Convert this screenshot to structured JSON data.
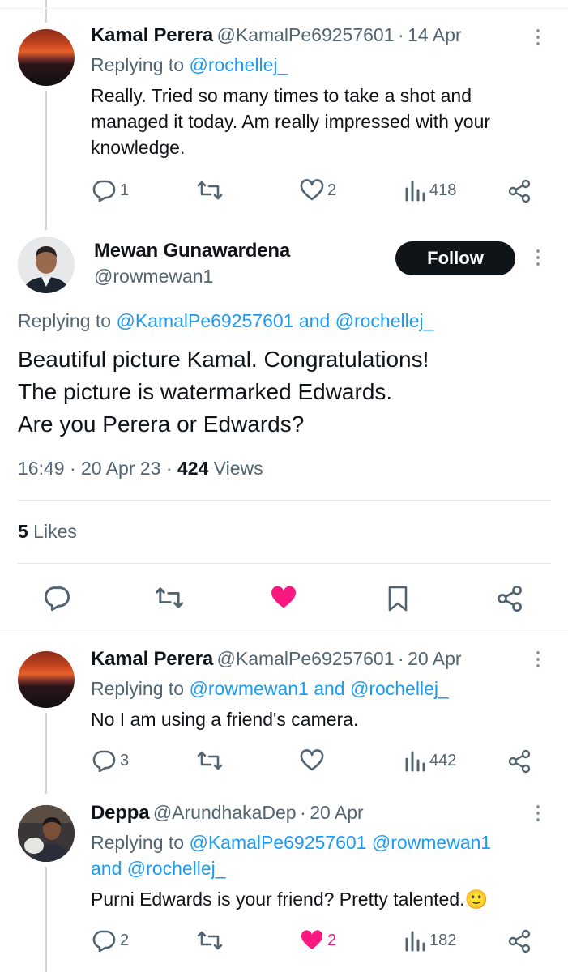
{
  "tweets": [
    {
      "name": "Kamal Perera",
      "handle": "@KamalPe69257601",
      "dot": "·",
      "date": "14 Apr",
      "replying_prefix": "Replying to",
      "replying_to": "@rochellej_",
      "text_lines": [
        "Really. Tried so many times to take a shot and",
        "managed it today. Am really impressed with your",
        "knowledge."
      ],
      "replies": "1",
      "retweets": "",
      "likes": "2",
      "views": "418"
    },
    {
      "name": "Kamal Perera",
      "handle": "@KamalPe69257601",
      "dot": "·",
      "date": "20 Apr",
      "replying_prefix": "Replying to",
      "replying_to": "@rowmewan1 and @rochellej_",
      "text_lines": [
        "No I am using a friend's camera."
      ],
      "replies": "3",
      "likes": "",
      "views": "442"
    },
    {
      "name": "Deppa",
      "handle": "@ArundhakaDep",
      "dot": "·",
      "date": "20 Apr",
      "replying_prefix": "Replying to",
      "replying_line1": "@KamalPe69257601 @rowmewan1",
      "replying_line2": "and @rochellej_",
      "text_lines": [
        "Purni Edwards is your friend? Pretty talented.🙂"
      ],
      "replies": "2",
      "likes": "2",
      "views": "182"
    }
  ],
  "main_tweet": {
    "name": "Mewan Gunawardena",
    "handle": "@rowmewan1",
    "follow_label": "Follow",
    "replying_prefix": "Replying to",
    "replying_to": "@KamalPe69257601 and @rochellej_",
    "text_lines": [
      "Beautiful picture Kamal. Congratulations!",
      "The picture is watermarked Edwards.",
      "Are you Perera or Edwards?"
    ],
    "time": "16:49 · 20 Apr 23 · ",
    "views_count": "424",
    "views_label": " Views",
    "likes_count": "5",
    "likes_label": " Likes"
  },
  "colors": {
    "accent": "#1d9bf0",
    "like": "#f91880",
    "text": "#0f1419",
    "secondary": "#536471"
  }
}
